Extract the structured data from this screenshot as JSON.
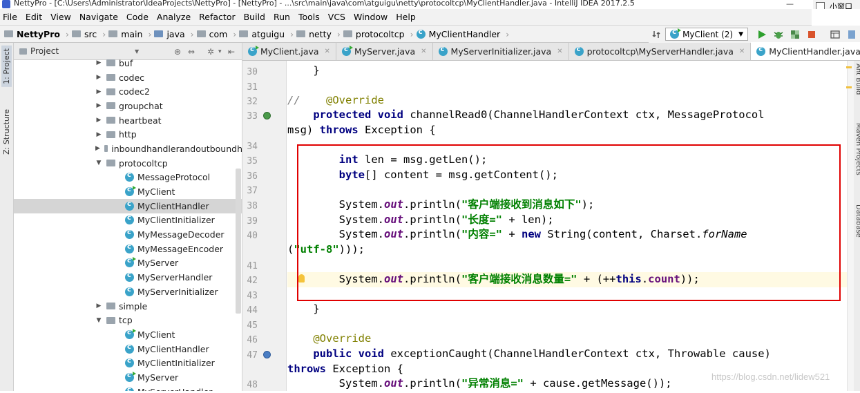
{
  "window": {
    "title": "NettyPro - [C:\\Users\\Administrator\\IdeaProjects\\NettyPro] - [NettyPro] - ...\\src\\main\\java\\com\\atguigu\\netty\\protocoltcp\\MyClientHandler.java - IntelliJ IDEA 2017.2.5",
    "side_widget": "小窗口"
  },
  "menu": [
    "File",
    "Edit",
    "View",
    "Navigate",
    "Code",
    "Analyze",
    "Refactor",
    "Build",
    "Run",
    "Tools",
    "VCS",
    "Window",
    "Help"
  ],
  "breadcrumbs": [
    "NettyPro",
    "src",
    "main",
    "java",
    "com",
    "atguigu",
    "netty",
    "protocoltcp",
    "MyClientHandler"
  ],
  "run_config": "MyClient (2)",
  "side_tabs": {
    "project": "1: Project",
    "structure": "Z: Structure"
  },
  "right_tabs": [
    "Ant Build",
    "Maven Projects",
    "Database"
  ],
  "project_panel": {
    "title": "Project",
    "tree": [
      {
        "label": "buf",
        "type": "folder",
        "expanded": false,
        "level": 1
      },
      {
        "label": "codec",
        "type": "folder",
        "expanded": false,
        "level": 1
      },
      {
        "label": "codec2",
        "type": "folder",
        "expanded": false,
        "level": 1
      },
      {
        "label": "groupchat",
        "type": "folder",
        "expanded": false,
        "level": 1
      },
      {
        "label": "heartbeat",
        "type": "folder",
        "expanded": false,
        "level": 1
      },
      {
        "label": "http",
        "type": "folder",
        "expanded": false,
        "level": 1
      },
      {
        "label": "inboundhandlerandoutboundh",
        "type": "folder",
        "expanded": false,
        "level": 1
      },
      {
        "label": "protocoltcp",
        "type": "folder",
        "expanded": true,
        "level": 1
      },
      {
        "label": "MessageProtocol",
        "type": "class",
        "level": 2
      },
      {
        "label": "MyClient",
        "type": "runclass",
        "level": 2
      },
      {
        "label": "MyClientHandler",
        "type": "class",
        "level": 2,
        "selected": true
      },
      {
        "label": "MyClientInitializer",
        "type": "class",
        "level": 2
      },
      {
        "label": "MyMessageDecoder",
        "type": "class",
        "level": 2
      },
      {
        "label": "MyMessageEncoder",
        "type": "class",
        "level": 2
      },
      {
        "label": "MyServer",
        "type": "runclass",
        "level": 2
      },
      {
        "label": "MyServerHandler",
        "type": "class",
        "level": 2
      },
      {
        "label": "MyServerInitializer",
        "type": "class",
        "level": 2
      },
      {
        "label": "simple",
        "type": "folder",
        "expanded": false,
        "level": 1
      },
      {
        "label": "tcp",
        "type": "folder",
        "expanded": true,
        "level": 1
      },
      {
        "label": "MyClient",
        "type": "runclass",
        "level": 2
      },
      {
        "label": "MyClientHandler",
        "type": "class",
        "level": 2
      },
      {
        "label": "MyClientInitializer",
        "type": "class",
        "level": 2
      },
      {
        "label": "MyServer",
        "type": "runclass",
        "level": 2
      },
      {
        "label": "MyServerHandler",
        "type": "class",
        "level": 2
      }
    ]
  },
  "editor_tabs": [
    {
      "label": "MyClient.java",
      "active": false
    },
    {
      "label": "MyServer.java",
      "active": false
    },
    {
      "label": "MyServerInitializer.java",
      "active": false
    },
    {
      "label": "protocoltcp\\MyServerHandler.java",
      "active": false
    },
    {
      "label": "MyClientHandler.java",
      "active": true
    }
  ],
  "code": {
    "line_numbers": [
      "30",
      "31",
      "32",
      "33",
      "",
      "34",
      "35",
      "36",
      "37",
      "38",
      "39",
      "40",
      "",
      "41",
      "42",
      "43",
      "44",
      "45",
      "46",
      "47",
      "",
      "48"
    ]
  },
  "watermark": "https://blog.csdn.net/lidew521"
}
